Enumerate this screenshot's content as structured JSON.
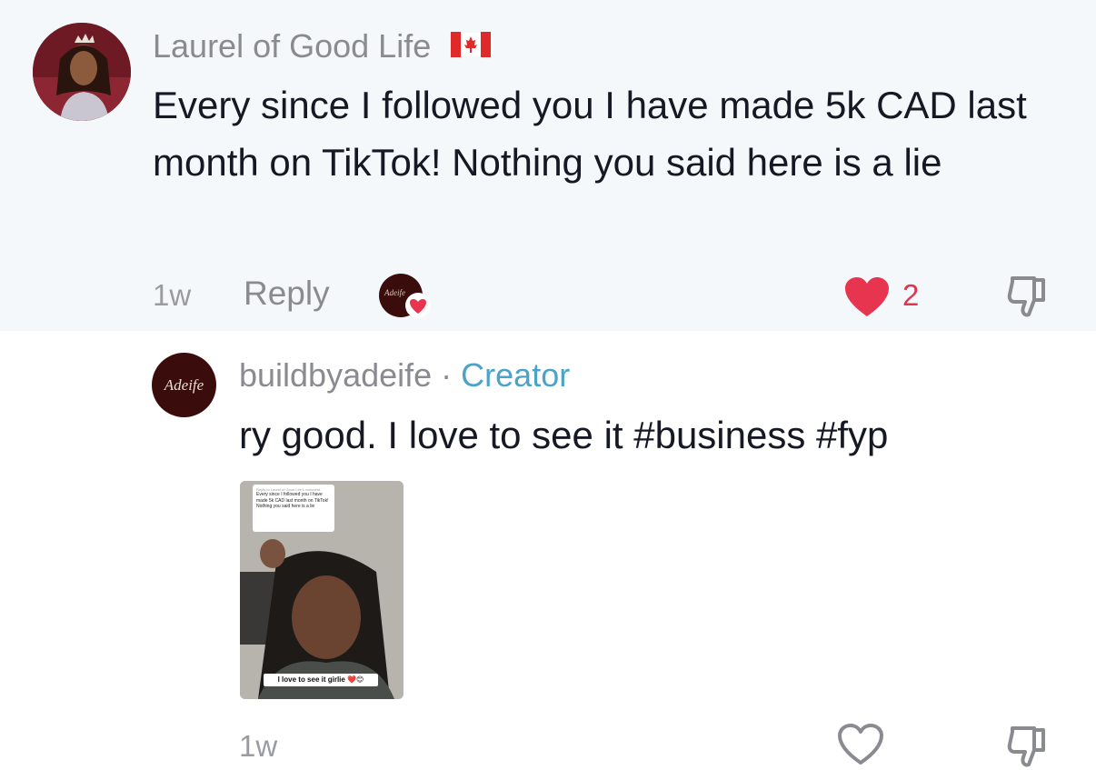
{
  "comment": {
    "username": "Laurel of Good Life",
    "text": "Every since I followed you I have made 5k CAD last month on TikTok! Nothing you said here is a lie",
    "time": "1w",
    "reply_label": "Reply",
    "like_count": "2",
    "mini_avatar_text": "Adeife"
  },
  "reply": {
    "username": "buildbyadeife",
    "separator": " · ",
    "badge": "Creator",
    "avatar_text": "Adeife",
    "text": "ry good. I love to see it  #business #fyp",
    "time": "1w",
    "thumbnail": {
      "card_header": "Reply to Laurel of Good Life's comment",
      "card_text": "Every since I followed you I have made 5k CAD last month on TikTok! Nothing you said here is a lie",
      "caption": "I love to see it girlie ❤️😊"
    }
  },
  "colors": {
    "like_red": "#e8354f",
    "creator_blue": "#4ba3c7",
    "highlight_bg": "#f4f8fb"
  },
  "icons": [
    "canada-flag-icon",
    "heart-icon",
    "dislike-icon",
    "heart-outline-icon"
  ]
}
